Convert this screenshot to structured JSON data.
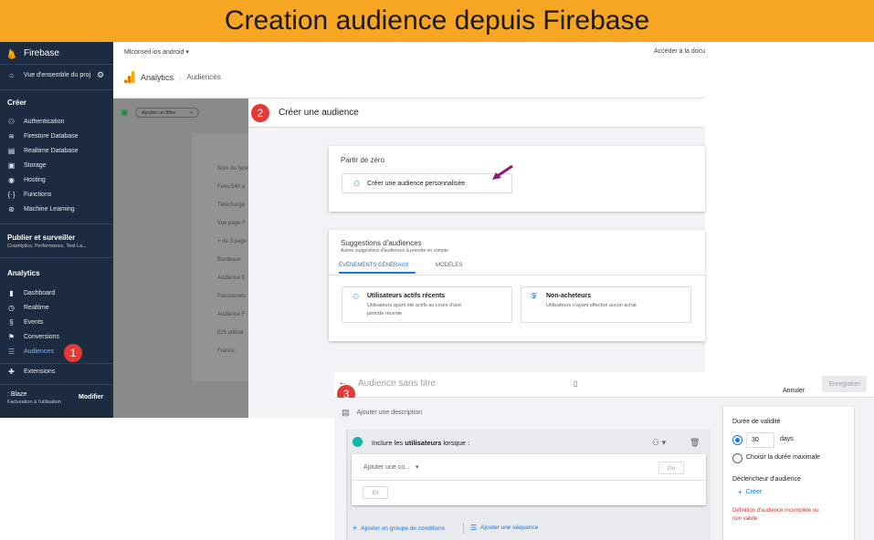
{
  "banner": {
    "title": "Creation audience depuis Firebase"
  },
  "sidebar": {
    "app_name": "Firebase",
    "project_overview": "Vue d'ensemble du proj",
    "section_build": "Créer",
    "build_items": [
      {
        "label": "Authentication",
        "icon": "people-icon"
      },
      {
        "label": "Firestore Database",
        "icon": "firestore-icon"
      },
      {
        "label": "Realtime Database",
        "icon": "database-icon"
      },
      {
        "label": "Storage",
        "icon": "storage-icon"
      },
      {
        "label": "Hosting",
        "icon": "hosting-icon"
      },
      {
        "label": "Functions",
        "icon": "functions-icon"
      },
      {
        "label": "Machine Learning",
        "icon": "ml-icon"
      }
    ],
    "section_release": "Publier et surveiller",
    "release_sub": "Crashlytics, Performance, Test La...",
    "section_analytics": "Analytics",
    "analytics_items": [
      {
        "label": "Dashboard",
        "icon": "bar-chart-icon"
      },
      {
        "label": "Realtime",
        "icon": "clock-icon"
      },
      {
        "label": "Events",
        "icon": "events-icon"
      },
      {
        "label": "Conversions",
        "icon": "flag-icon"
      },
      {
        "label": "Audiences",
        "icon": "audience-list-icon"
      }
    ],
    "extensions": "Extensions",
    "plan_name": ": Blaze",
    "plan_sub": "Facturation à l'utilisation",
    "modify": "Modifier"
  },
  "console": {
    "project_select": "Mlconseil ios android",
    "docs_link": "Accéder à la docu",
    "analytics_title": "Analytics",
    "breadcrumb_section": "Audiences",
    "filter_button": "Ajouter un filtre",
    "dim_rows": [
      "Nom du type",
      "Fees 540 a",
      "Télécharge",
      "Vue page F",
      "+ de 3 page",
      "Bordeaux",
      "Audience fi",
      "Passionnés",
      "Audience F",
      "iOS utilisat",
      "France"
    ]
  },
  "create": {
    "title": "Créer une audience",
    "from_scratch_heading": "Partir de zéro",
    "custom_audience_button": "Créer une audience personnalisée",
    "suggestions_heading": "Suggestions d'audiences",
    "suggestions_sub": "Autres suggestions d'audiences à prendre en compte",
    "tabs": [
      "ÉVÉNEMENTS GÉNÉRAUX",
      "MODÈLES"
    ],
    "suggestion_cards": [
      {
        "title": "Utilisateurs actifs récents",
        "desc_line1": "Utilisateurs ayant été actifs au cours d'une",
        "desc_line2": "période récente"
      },
      {
        "title": "Non-acheteurs",
        "desc_line1": "Utilisateurs n'ayant effectué aucun achat",
        "desc_line2": ""
      }
    ]
  },
  "editor": {
    "title_placeholder": "Audience sans titre",
    "cancel": "Annuler",
    "save": "Enregistrer",
    "add_description": "Ajouter une description",
    "include_prefix": "Inclure les ",
    "include_bold": "utilisateurs",
    "include_suffix": " lorsque :",
    "add_condition": "Ajouter une co...",
    "or_button": "Ou",
    "and_button": "Et",
    "add_group": "Ajouter un groupe de conditions",
    "add_sequence": "Ajouter une séquence",
    "validity_heading": "Durée de validité",
    "validity_value": "30",
    "validity_unit": "days",
    "max_duration": "Choisir la durée maximale",
    "trigger_heading": "Déclencheur d'audience",
    "trigger_create": "Créer",
    "error_line1": "Définition d'audience incomplète ou",
    "error_line2": "non valide"
  },
  "steps": [
    "1",
    "2",
    "3"
  ],
  "colors": {
    "banner": "#f6a623",
    "sidebar": "#1c2b3f",
    "accent_blue": "#1a73e8",
    "error": "#d93025",
    "badge": "#e53935",
    "include_dot": "#12b5a8"
  }
}
